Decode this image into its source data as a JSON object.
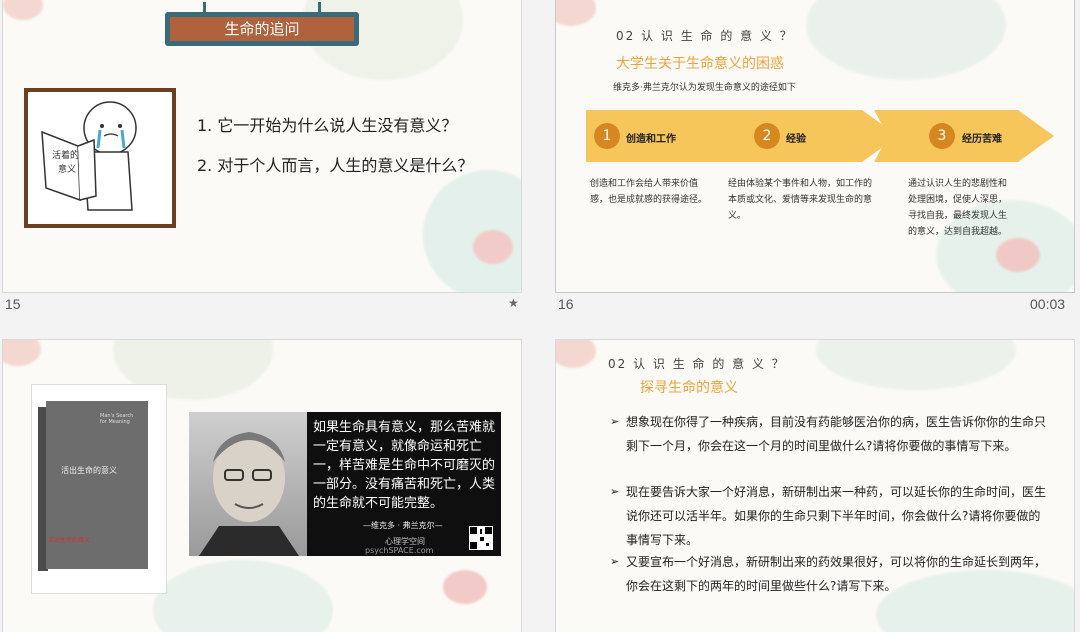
{
  "slides": [
    {
      "number": "15",
      "badge": "★",
      "title": "生命的追问",
      "illustration_text": "活着的意义",
      "questions": [
        "1. 它一开始为什么说人生没有意义？",
        "2. 对于个人而言，人生的意义是什么？"
      ]
    },
    {
      "number": "16",
      "duration": "00:03",
      "section": "02 认 识 生 命 的 意 义 ？",
      "subtitle": "大学生关于生命意义的困惑",
      "lead": "维克多·弗兰克尔认为发现生命意义的途径如下",
      "steps": [
        {
          "num": "1",
          "label": "创造和工作",
          "desc": "创造和工作会给人带来价值感，也是成就感的获得途径。"
        },
        {
          "num": "2",
          "label": "经验",
          "desc": "经由体验某个事件和人物，如工作的本质或文化、爱情等来发现生命的意义。"
        },
        {
          "num": "3",
          "label": "经历苦难",
          "desc": "通过认识人生的悲剧性和处理困境，促使人深思，寻找自我，最终发现人生的意义，达到自我超越。"
        }
      ]
    },
    {
      "book": {
        "title": "活出生命的意义",
        "english": "Man's Search for Meaning",
        "tagline": "活出生命的意义"
      },
      "quote": "如果生命具有意义，那么苦难就一定有意义，就像命运和死亡一，样苦难是生命中不可磨灭的一部分。没有痛苦和死亡，人类的生命就不可能完整。",
      "author": "—维克多 · 弗兰克尔—",
      "site": "心理学空间",
      "url": "psychSPACE.com"
    },
    {
      "section": "02 认 识 生 命 的 意 义 ？",
      "subtitle": "探寻生命的意义",
      "bullets": [
        "想象现在你得了一种疾病，目前没有药能够医治你的病，医生告诉你你的生命只剩下一个月，你会在这一个月的时间里做什么?请将你要做的事情写下来。",
        "现在要告诉大家一个好消息，新研制出来一种药，可以延长你的生命时间，医生说你还可以活半年。如果你的生命只剩下半年时间，你会做什么?请将你要做的事情写下来。",
        "又要宣布一个好消息，新研制出来的药效果很好，可以将你的生命延长到两年，你会在这剩下的两年的时间里做些什么?请写下来。"
      ]
    }
  ],
  "colors": {
    "accent": "#f0a23a",
    "arrow": "#f6c65b",
    "badge": "#d7871f",
    "title_bar": "#3a6b7a",
    "title_fill": "#b0623e"
  }
}
